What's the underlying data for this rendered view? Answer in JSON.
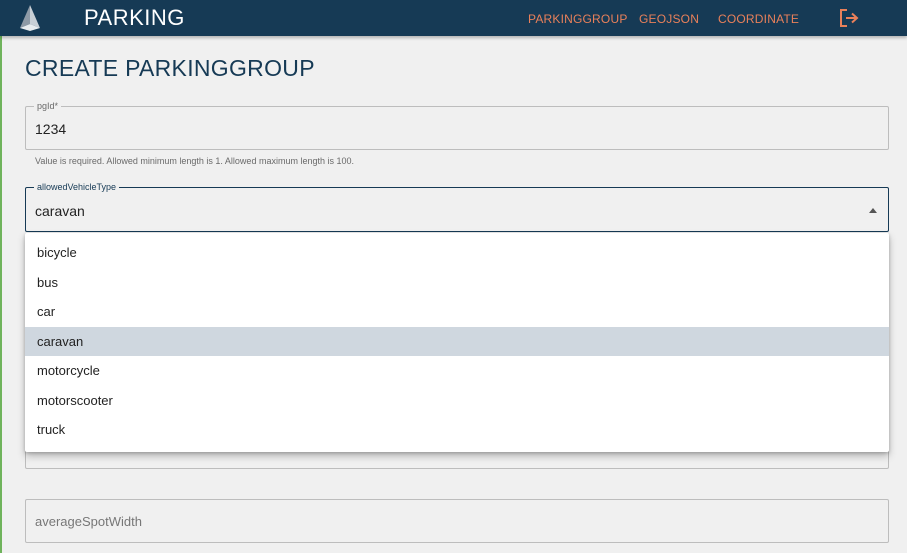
{
  "app": {
    "title": "PARKING"
  },
  "nav": {
    "items": [
      {
        "label": "PARKINGGROUP"
      },
      {
        "label": "GEOJSON"
      },
      {
        "label": "COORDINATE"
      }
    ],
    "logout_icon": "logout-icon"
  },
  "page": {
    "title": "CREATE PARKINGGROUP"
  },
  "form": {
    "pgId": {
      "label": "pgId*",
      "value": "1234",
      "hint": "Value is required. Allowed minimum length is 1. Allowed maximum length is 100."
    },
    "allowedVehicleType": {
      "label": "allowedVehicleType",
      "value": "caravan",
      "options": [
        "bicycle",
        "bus",
        "car",
        "caravan",
        "motorcycle",
        "motorscooter",
        "truck"
      ],
      "selected_index": 3
    },
    "averageSpotWidth": {
      "placeholder": "averageSpotWidth"
    }
  },
  "colors": {
    "header_bg": "#163a55",
    "nav_link": "#e9805a",
    "title": "#163a55",
    "selected_option_bg": "#cfd7df"
  }
}
